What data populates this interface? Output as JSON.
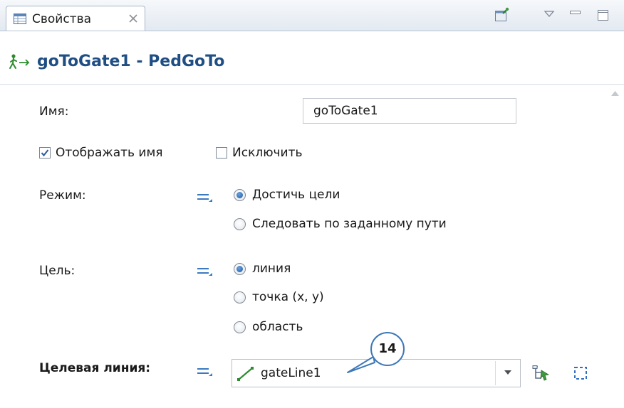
{
  "tab": {
    "label": "Свойства"
  },
  "header": {
    "title": "goToGate1 - PedGoTo"
  },
  "form": {
    "name_label": "Имя:",
    "name_value": "goToGate1",
    "show_name_label": "Отображать имя",
    "show_name_checked": true,
    "exclude_label": "Исключить",
    "exclude_checked": false,
    "mode_label": "Режим:",
    "mode_options": [
      "Достичь цели",
      "Следовать по заданному пути"
    ],
    "mode_selected": "Достичь цели",
    "target_label": "Цель:",
    "target_options": [
      "линия",
      "точка (x, y)",
      "область"
    ],
    "target_selected": "линия",
    "target_line_label": "Целевая линия:",
    "target_line_value": "gateLine1"
  },
  "callout": {
    "number": "14"
  },
  "colors": {
    "title": "#1f4e84",
    "accent": "#3e78b8",
    "line_icon": "#2e8b2e"
  },
  "icons": {
    "tab": "properties-table-icon",
    "tab_close": "close-icon",
    "pin": "pin-icon",
    "view_menu": "view-menu-icon",
    "minimize": "minimize-icon",
    "maximize": "maximize-icon",
    "object": "pedestrian-goto-icon",
    "static_value": "static-value-icon",
    "line": "line-icon",
    "select_in_model": "select-in-model-icon",
    "select_area": "select-area-icon"
  }
}
